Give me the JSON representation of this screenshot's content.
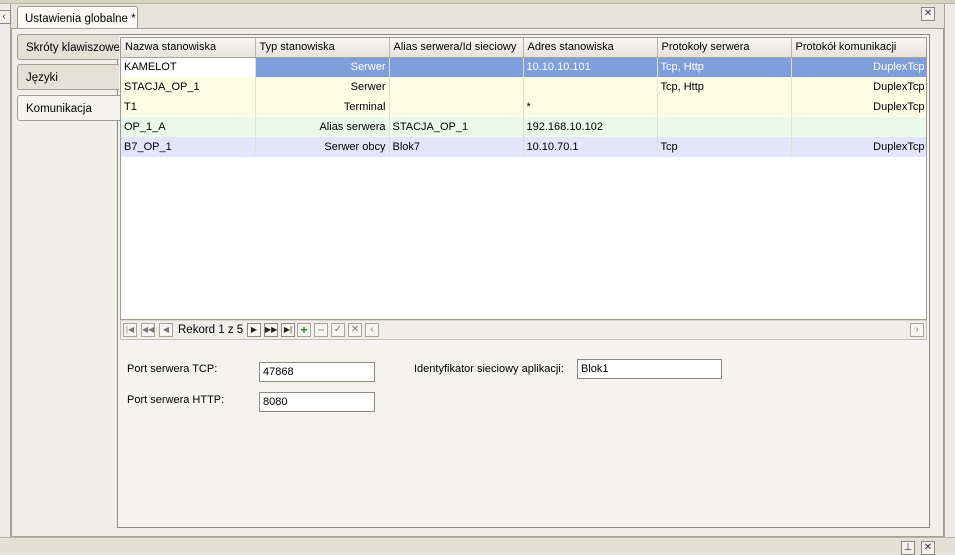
{
  "tab": {
    "title": "Ustawienia globalne *"
  },
  "side_tabs": [
    {
      "label": "Skróty klawiszowe"
    },
    {
      "label": "Języki"
    },
    {
      "label": "Komunikacja"
    }
  ],
  "grid": {
    "columns": [
      "Nazwa stanowiska",
      "Typ stanowiska",
      "Alias serwera/Id sieciowy",
      "Adres stanowiska",
      "Protokoły serwera",
      "Protokół komunikacji"
    ],
    "rows": [
      [
        "KAMELOT",
        "Serwer",
        "",
        "10.10.10.101",
        "Tcp, Http",
        "DuplexTcp"
      ],
      [
        "STACJA_OP_1",
        "Serwer",
        "",
        "",
        "Tcp, Http",
        "DuplexTcp"
      ],
      [
        "T1",
        "Terminal",
        "",
        "*",
        "",
        "DuplexTcp"
      ],
      [
        "OP_1_A",
        "Alias serwera",
        "STACJA_OP_1",
        "192.168.10.102",
        "",
        ""
      ],
      [
        "B7_OP_1",
        "Serwer obcy",
        "Blok7",
        "10.10.70.1",
        "Tcp",
        "DuplexTcp"
      ]
    ]
  },
  "navigator": {
    "record_label": "Rekord 1 z 5",
    "buttons": [
      "first",
      "prev-page",
      "prev",
      "next",
      "next-page",
      "last",
      "add",
      "remove",
      "confirm",
      "cancel",
      "scroll-left",
      "scroll-right"
    ]
  },
  "form": {
    "tcp_label": "Port serwera TCP:",
    "tcp_value": "47868",
    "http_label": "Port serwera HTTP:",
    "http_value": "8080",
    "appid_label": "Identyfikator sieciowy aplikacji:",
    "appid_value": "Blok1"
  },
  "colors": {
    "selection": "#7e9fdc",
    "row_server": "#fdfce5",
    "row_alias": "#eaf9ea",
    "row_foreign": "#e4e4fa"
  }
}
